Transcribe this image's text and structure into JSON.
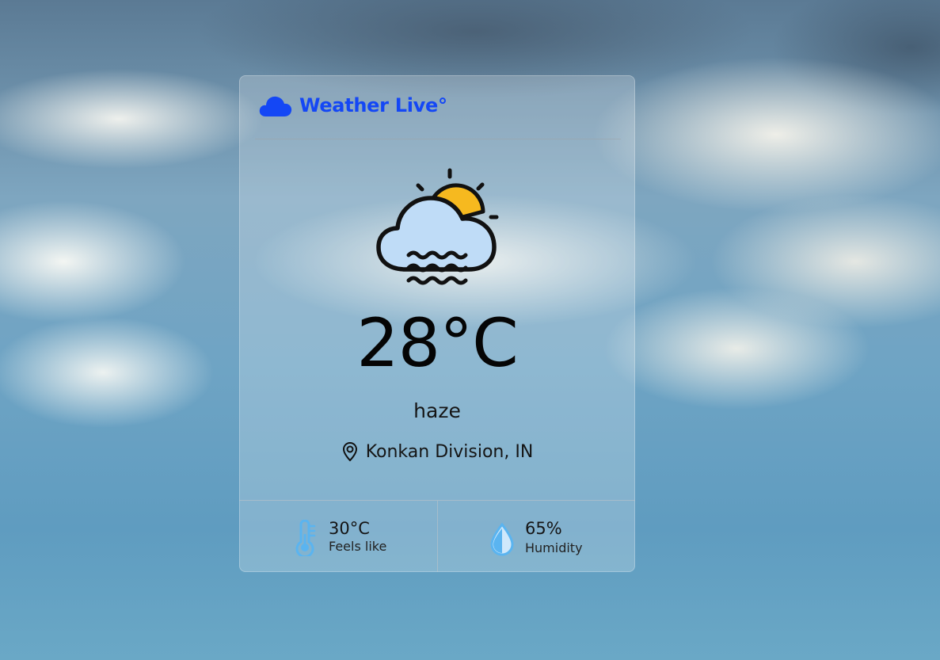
{
  "app": {
    "title": "Weather Live°",
    "brand_icon": "cloud-icon",
    "accent_color": "#1447f5"
  },
  "current": {
    "temperature": "28°C",
    "condition": "haze",
    "condition_icon": "haze-sun-cloud-icon",
    "location": "Konkan Division, IN",
    "location_icon": "map-pin-icon"
  },
  "stats": {
    "feels_like": {
      "value": "30°C",
      "label": "Feels like",
      "icon": "thermometer-icon"
    },
    "humidity": {
      "value": "65%",
      "label": "Humidity",
      "icon": "water-drop-icon"
    }
  },
  "colors": {
    "stat_icon": "#5ab4f0",
    "sun": "#f6b91f",
    "cloud_fill": "#bfdcf7"
  }
}
